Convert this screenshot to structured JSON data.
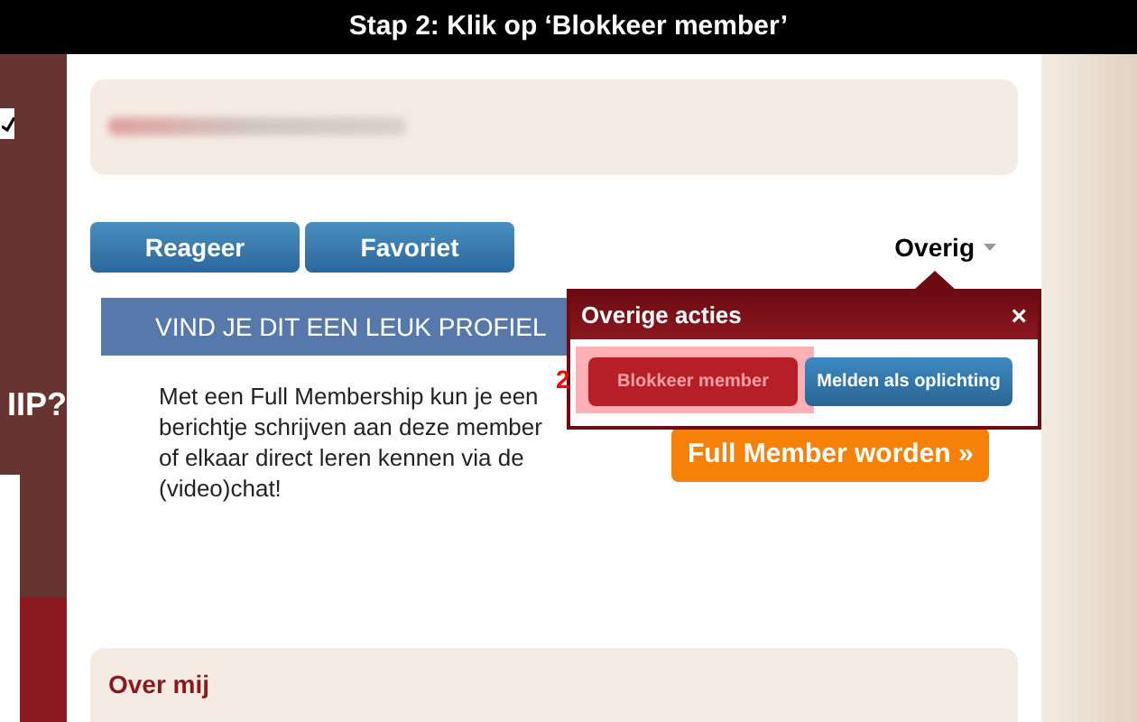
{
  "caption": "Stap 2: Klik op ‘Blokkeer member’",
  "sidebar": {
    "checkbox": {
      "checked": true
    },
    "heading": "IIP?"
  },
  "actions": [
    {
      "label": "Reageer"
    },
    {
      "label": "Favoriet"
    }
  ],
  "more_menu": {
    "label": "Overig",
    "expanded": true
  },
  "banner": "VIND JE DIT EEN LEUK PROFIEL",
  "promo_text": "Met een Full Membership kun je een berichtje schrijven aan deze member of elkaar direct leren kennen via de (video)chat!",
  "cta": "Full Member worden »",
  "popup": {
    "title": "Overige acties",
    "close": "×",
    "step": "2",
    "buttons": [
      {
        "label": "Blokkeer member",
        "kind": "danger",
        "highlighted": true
      },
      {
        "label": "Melden als oplichting",
        "kind": "primary",
        "highlighted": false
      }
    ]
  },
  "about": {
    "heading": "Over mij"
  }
}
